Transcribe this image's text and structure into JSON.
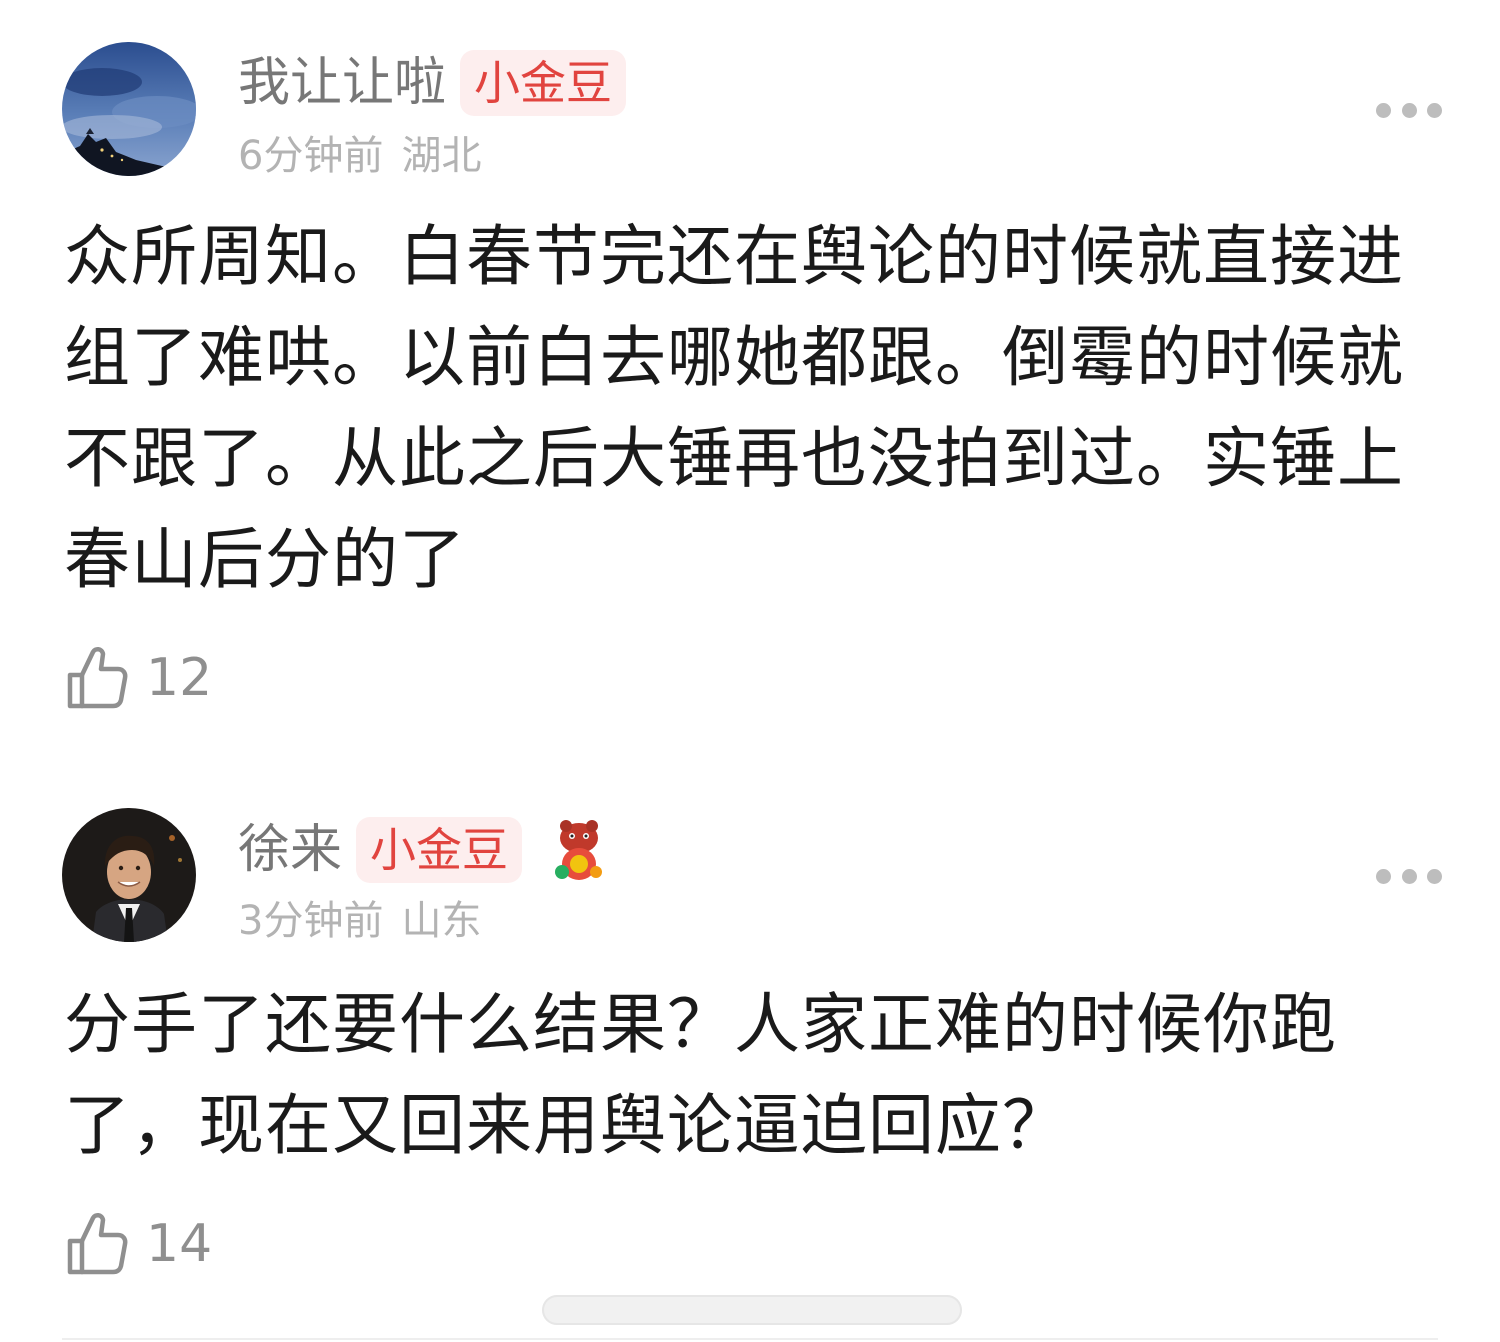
{
  "comments": [
    {
      "username": "我让让啦",
      "badge": "小金豆",
      "time": "6分钟前",
      "location": "湖北",
      "content": "众所周知。白春节完还在舆论的时候就直接进组了难哄。以前白去哪她都跟。倒霉的时候就不跟了。从此之后大锤再也没拍到过。实锤上春山后分的了",
      "likes": "12",
      "avatar_icon": "night-sky-castle-avatar"
    },
    {
      "username": "徐来",
      "badge": "小金豆",
      "time": "3分钟前",
      "location": "山东",
      "content": "分手了还要什么结果？人家正难的时候你跑了，现在又回来用舆论逼迫回应？",
      "likes": "14",
      "avatar_icon": "smiling-man-suit-avatar",
      "decoration_icon": "red-lion-mascot-icon"
    }
  ],
  "colors": {
    "username": "#777777",
    "badge_text": "#e1443f",
    "badge_bg": "#fdeeee",
    "meta": "#b3b3b3",
    "content": "#1a1a1a",
    "like": "#8f8f8f"
  }
}
